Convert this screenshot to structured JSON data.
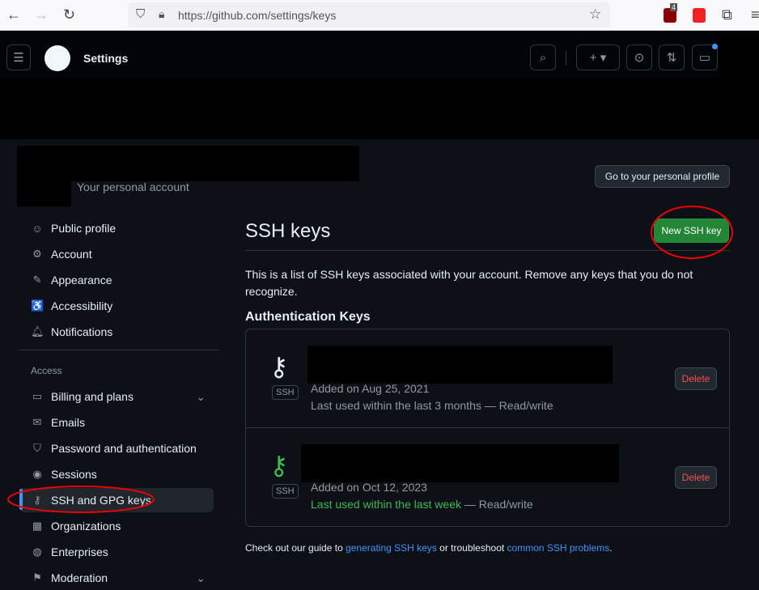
{
  "browser": {
    "url": "https://github.com/settings/keys",
    "badge": "4"
  },
  "header": {
    "title": "Settings"
  },
  "account": {
    "subtitle": "Your personal account",
    "profile_button": "Go to your personal profile"
  },
  "sidebar": {
    "items": [
      {
        "label": "Public profile",
        "icon": "person-icon"
      },
      {
        "label": "Account",
        "icon": "gear-icon"
      },
      {
        "label": "Appearance",
        "icon": "paintbrush-icon"
      },
      {
        "label": "Accessibility",
        "icon": "accessibility-icon"
      },
      {
        "label": "Notifications",
        "icon": "bell-icon"
      }
    ],
    "section": "Access",
    "access_items": [
      {
        "label": "Billing and plans",
        "icon": "credit-card-icon"
      },
      {
        "label": "Emails",
        "icon": "mail-icon"
      },
      {
        "label": "Password and authentication",
        "icon": "shield-icon"
      },
      {
        "label": "Sessions",
        "icon": "broadcast-icon"
      },
      {
        "label": "SSH and GPG keys",
        "icon": "key-icon"
      },
      {
        "label": "Organizations",
        "icon": "organization-icon"
      },
      {
        "label": "Enterprises",
        "icon": "globe-icon"
      },
      {
        "label": "Moderation",
        "icon": "report-icon"
      }
    ]
  },
  "main": {
    "title": "SSH keys",
    "new_button": "New SSH key",
    "description": "This is a list of SSH keys associated with your account. Remove any keys that you do not recognize.",
    "auth_heading": "Authentication Keys",
    "keys": [
      {
        "badge": "SSH",
        "added": "Added on Aug 25, 2021",
        "last_used": "Last used within the last 3 months",
        "access": " — Read/write",
        "delete": "Delete"
      },
      {
        "badge": "SSH",
        "added": "Added on Oct 12, 2023",
        "last_used": "Last used within the last week",
        "access": " — Read/write",
        "delete": "Delete"
      }
    ],
    "footer": {
      "pre": "Check out our guide to ",
      "link1": "generating SSH keys",
      "mid": " or troubleshoot ",
      "link2": "common SSH problems",
      "post": "."
    }
  },
  "colors": {
    "bg": "#0d1117",
    "accent_green": "#238636",
    "link": "#4493f8",
    "danger": "#f85149"
  }
}
